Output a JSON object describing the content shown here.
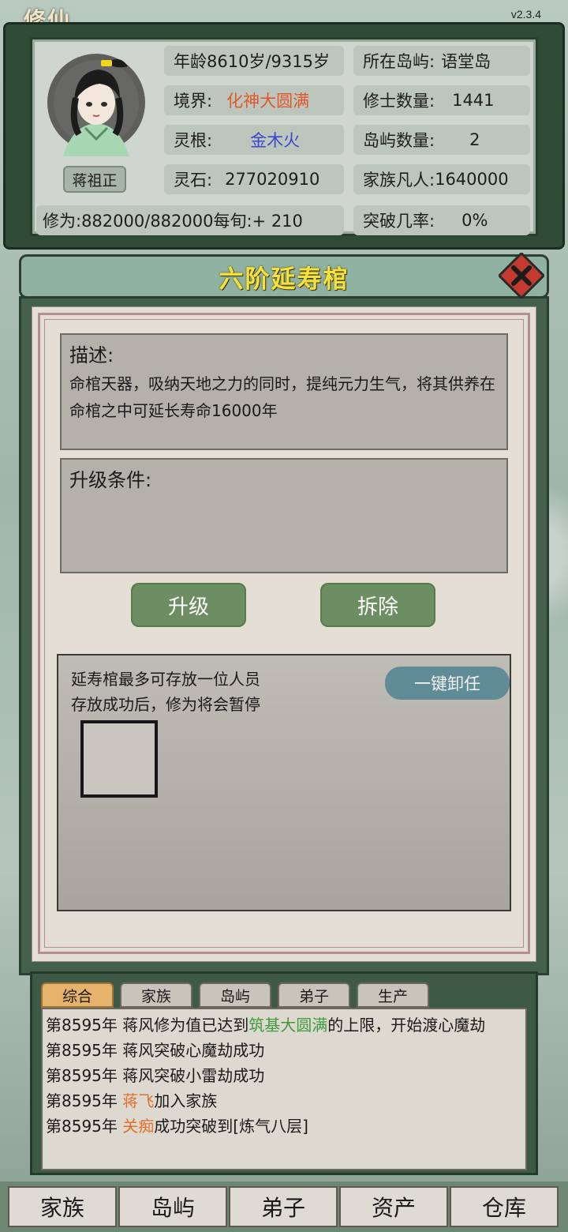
{
  "app": {
    "corner_title": "修仙",
    "version": "v2.3.4"
  },
  "character": {
    "name": "蒋祖正",
    "age_label": "年龄",
    "age_value": "8610岁/9315岁",
    "island_label": "所在岛屿:",
    "island_value": "语堂岛",
    "realm_label": "境界:",
    "realm_value": "化神大圆满",
    "cultivators_label": "修士数量:",
    "cultivators_value": "1441",
    "root_label": "灵根:",
    "root_value": "金木火",
    "islands_count_label": "岛屿数量:",
    "islands_count_value": "2",
    "stones_label": "灵石:",
    "stones_value": "277020910",
    "mortals_label": "家族凡人:",
    "mortals_value": "1640000",
    "cultivation_text": "修为:882000/882000每旬:+ 210",
    "breakthrough_label": "突破几率:",
    "breakthrough_value": "0%"
  },
  "dialog": {
    "title": "六阶延寿棺",
    "desc_heading": "描述:",
    "desc_text": "命棺天器，吸纳天地之力的同时，提纯元力生气，将其供养在命棺之中可延长寿命16000年",
    "req_heading": "升级条件:",
    "upgrade_label": "升级",
    "dismantle_label": "拆除",
    "store_line1": "延寿棺最多可存放一位人员",
    "store_line2": "存放成功后，修为将会暂停",
    "unload_label": "一键卸任"
  },
  "log": {
    "tabs": [
      "综合",
      "家族",
      "岛屿",
      "弟子",
      "生产"
    ],
    "entries": {
      "e1_prefix": "第8595年 蒋风修为值已达到",
      "e1_highlight": "筑基大圆满",
      "e1_suffix": "的上限，开始渡心魔劫",
      "e2": "第8595年 蒋风突破心魔劫成功",
      "e3": "第8595年 蒋风突破小雷劫成功",
      "e4_prefix": "第8595年 ",
      "e4_highlight": "蒋飞",
      "e4_suffix": "加入家族",
      "e5_prefix": "第8595年 ",
      "e5_highlight": "关痴",
      "e5_suffix": "成功突破到[炼气八层]"
    }
  },
  "nav": [
    "家族",
    "岛屿",
    "弟子",
    "资产",
    "仓库"
  ],
  "colors": {
    "realm": "#e2572a",
    "root": "#3b46d0",
    "title": "#f6e23b",
    "highlight_green": "#3f9b3c",
    "highlight_orange": "#e2702a"
  }
}
